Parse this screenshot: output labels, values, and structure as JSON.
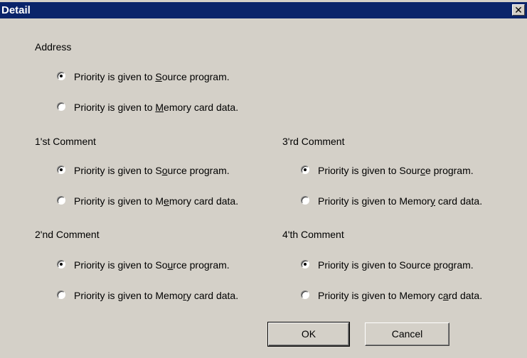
{
  "window": {
    "title": "Detail",
    "close_glyph": "✕"
  },
  "groups": {
    "address": {
      "label": "Address",
      "options": [
        {
          "pre": "Priority is given to ",
          "key": "S",
          "post": "ource program.",
          "checked": true
        },
        {
          "pre": "Priority is given to ",
          "key": "M",
          "post": "emory card data.",
          "checked": false
        }
      ]
    },
    "comment1": {
      "label": "1'st Comment",
      "options": [
        {
          "pre": "Priority is given to S",
          "key": "o",
          "post": "urce program.",
          "checked": true
        },
        {
          "pre": "Priority is given to M",
          "key": "e",
          "post": "mory card data.",
          "checked": false
        }
      ]
    },
    "comment2": {
      "label": "2'nd Comment",
      "options": [
        {
          "pre": "Priority is given to So",
          "key": "u",
          "post": "rce program.",
          "checked": true
        },
        {
          "pre": "Priority is given to Memo",
          "key": "r",
          "post": "y card data.",
          "checked": false
        }
      ]
    },
    "comment3": {
      "label": "3'rd Comment",
      "options": [
        {
          "pre": "Priority is given to Sour",
          "key": "c",
          "post": "e program.",
          "checked": true
        },
        {
          "pre": "Priority is given to Memor",
          "key": "y",
          "post": " card data.",
          "checked": false
        }
      ]
    },
    "comment4": {
      "label": "4'th Comment",
      "options": [
        {
          "pre": "Priority is given to Source ",
          "key": "p",
          "post": "rogram.",
          "checked": true
        },
        {
          "pre": "Priority is given to Memory c",
          "key": "a",
          "post": "rd data.",
          "checked": false
        }
      ]
    }
  },
  "buttons": {
    "ok": "OK",
    "cancel": "Cancel"
  }
}
